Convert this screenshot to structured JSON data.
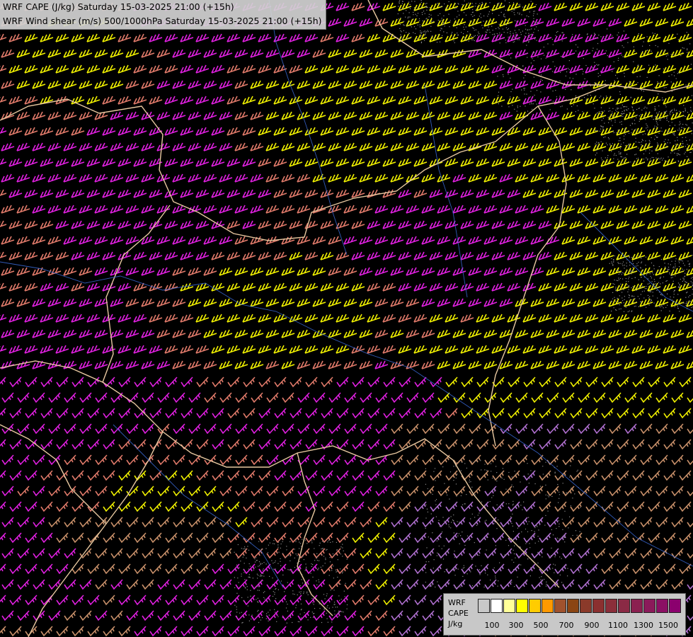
{
  "title": {
    "line1": "WRF CAPE (J/kg) Saturday 15-03-2025 21:00 (+15h)",
    "line2": "WRF Wind shear (m/s) 500/1000hPa Saturday 15-03-2025 21:00 (+15h)"
  },
  "legend": {
    "label_lines": [
      "WRF",
      "CAPE",
      "J/kg"
    ],
    "swatch_colors": [
      "#c8c8c8",
      "#ffffff",
      "#ffff99",
      "#ffff00",
      "#ffcc00",
      "#ff9900",
      "#a0522d",
      "#8b4513",
      "#8b3a2a",
      "#8b3030",
      "#8b2e3a",
      "#8b2a45",
      "#8b2050",
      "#8b1a5a",
      "#8b1064",
      "#8b006e"
    ],
    "ticks": [
      "100",
      "300",
      "500",
      "700",
      "900",
      "1100",
      "1300",
      "1500"
    ]
  },
  "colors": {
    "background": "#000000",
    "barb_magenta": "#e020e0",
    "barb_pink": "#e07a6a",
    "barb_yellow": "#f0f000",
    "barb_tan": "#c8906a",
    "barb_violet": "#b070d0",
    "border": "#e8c8a0",
    "river": "#3a6ad8"
  }
}
